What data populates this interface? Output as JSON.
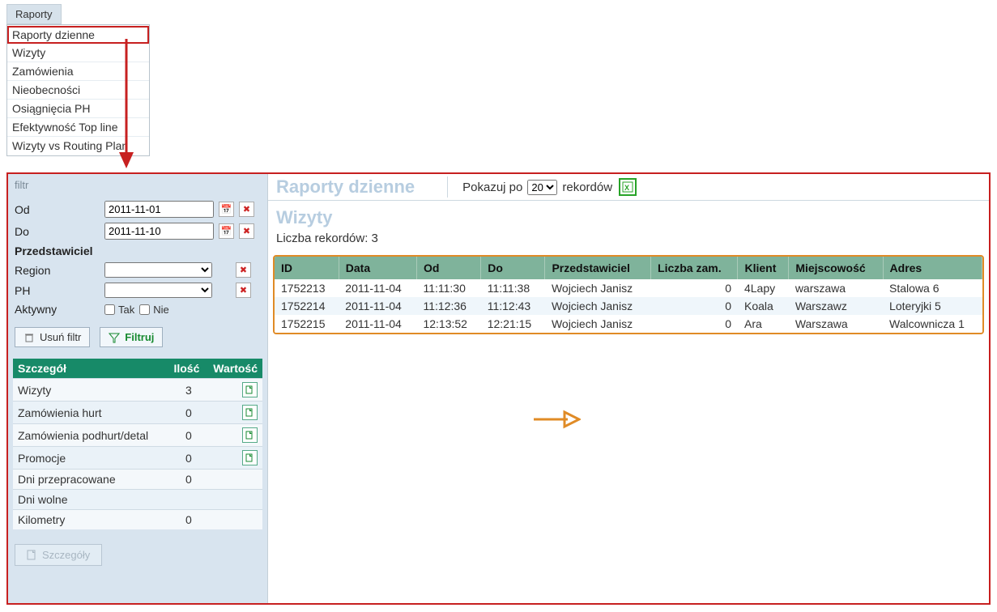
{
  "menu": {
    "button": "Raporty",
    "highlight": "Raporty dzienne",
    "items": [
      "Wizyty",
      "Zamówienia",
      "Nieobecności",
      "Osiągnięcia PH",
      "Efektywność Top line",
      "Wizyty vs Routing Plan"
    ]
  },
  "filter": {
    "title": "filtr",
    "od_label": "Od",
    "od_value": "2011-11-01",
    "do_label": "Do",
    "do_value": "2011-11-10",
    "przedstawiciel_label": "Przedstawiciel",
    "region_label": "Region",
    "region_value": "",
    "ph_label": "PH",
    "ph_value": "",
    "aktywny_label": "Aktywny",
    "tak_label": "Tak",
    "nie_label": "Nie",
    "clear_btn": "Usuń filtr",
    "filter_btn": "Filtruj",
    "details_btn": "Szczegóły"
  },
  "summary": {
    "headers": {
      "col1": "Szczegół",
      "col2": "Ilość",
      "col3": "Wartość"
    },
    "rows": [
      {
        "label": "Wizyty",
        "count": "3",
        "value": "",
        "detail": true
      },
      {
        "label": "Zamówienia hurt",
        "count": "0",
        "value": "",
        "detail": true
      },
      {
        "label": "Zamówienia podhurt/detal",
        "count": "0",
        "value": "",
        "detail": true
      },
      {
        "label": "Promocje",
        "count": "0",
        "value": "",
        "detail": true
      },
      {
        "label": "Dni przepracowane",
        "count": "0",
        "value": "",
        "detail": false
      },
      {
        "label": "Dni wolne",
        "count": "",
        "value": "",
        "detail": false
      },
      {
        "label": "Kilometry",
        "count": "0",
        "value": "",
        "detail": false
      }
    ]
  },
  "right": {
    "title": "Raporty dzienne",
    "pager_prefix": "Pokazuj po",
    "pager_value": "20",
    "pager_suffix": "rekordów",
    "section": "Wizyty",
    "record_count": "Liczba rekordów: 3",
    "headers": [
      "ID",
      "Data",
      "Od",
      "Do",
      "Przedstawiciel",
      "Liczba zam.",
      "Klient",
      "Miejscowość",
      "Adres"
    ],
    "rows": [
      {
        "id": "1752213",
        "data": "2011-11-04",
        "od": "11:11:30",
        "do": "11:11:38",
        "przed": "Wojciech Janisz",
        "liczba": "0",
        "klient": "4Lapy",
        "miej": "warszawa",
        "adres": "Stalowa 6"
      },
      {
        "id": "1752214",
        "data": "2011-11-04",
        "od": "11:12:36",
        "do": "11:12:43",
        "przed": "Wojciech Janisz",
        "liczba": "0",
        "klient": "Koala",
        "miej": "Warszawz",
        "adres": "Loteryjki 5"
      },
      {
        "id": "1752215",
        "data": "2011-11-04",
        "od": "12:13:52",
        "do": "12:21:15",
        "przed": "Wojciech Janisz",
        "liczba": "0",
        "klient": "Ara",
        "miej": "Warszawa",
        "adres": "Walcownicza 1"
      }
    ]
  }
}
